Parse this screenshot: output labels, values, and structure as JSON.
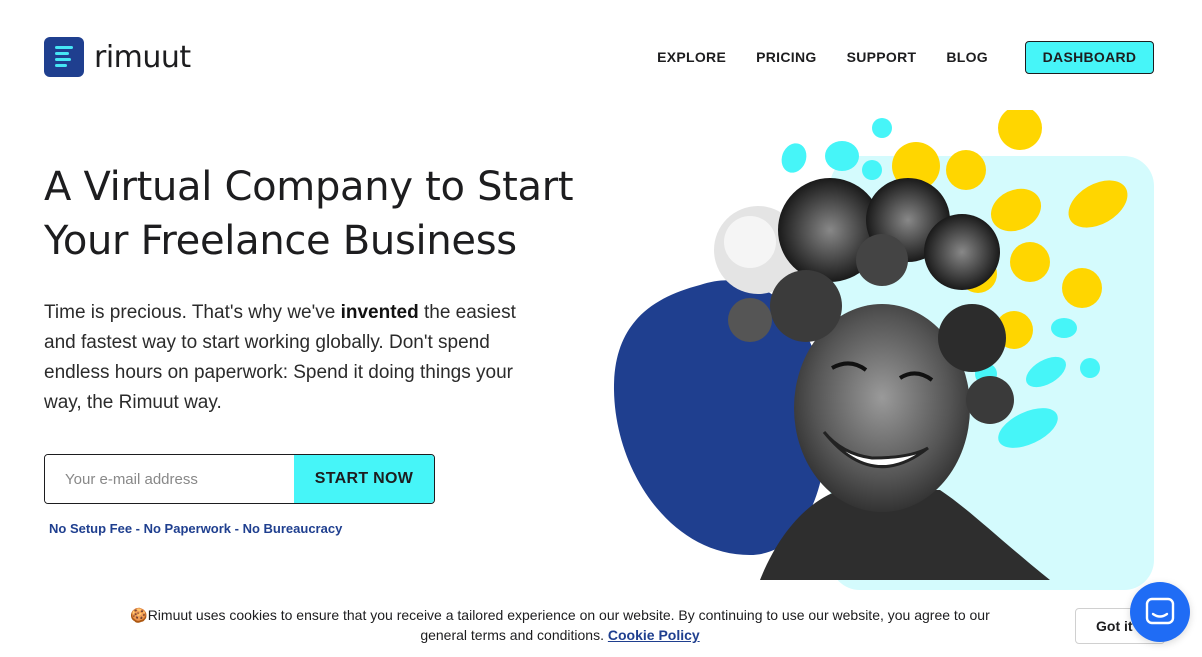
{
  "brand": {
    "name": "rimuut"
  },
  "nav": {
    "items": [
      "EXPLORE",
      "PRICING",
      "SUPPORT",
      "BLOG"
    ],
    "dashboard_label": "DASHBOARD"
  },
  "hero": {
    "title": "A Virtual Company to Start Your Freelance Business",
    "desc_before": "Time is precious. That's why we've ",
    "desc_bold": "invented",
    "desc_after": " the easiest and fastest way to start working globally. Don't spend endless hours on paperwork: Spend it doing things your way, the Rimuut way.",
    "email_placeholder": "Your e-mail address",
    "cta_label": "START NOW",
    "tagline": "No Setup Fee - No Paperwork - No Bureaucracy"
  },
  "cookie": {
    "emoji": "🍪",
    "text": "Rimuut uses cookies to ensure that you receive a tailored experience on our website. By continuing to use our website, you agree to our general terms and conditions.",
    "link_label": "Cookie Policy",
    "accept_label": "Got it"
  },
  "colors": {
    "brand_blue": "#1f3f8f",
    "accent_cyan": "#46f5f8",
    "light_cyan": "#d4fbfd",
    "yellow": "#ffd600",
    "chat_blue": "#1f6cf5"
  },
  "icons": {
    "logo": "rimuut-logo-icon",
    "chat": "chat-bubble-icon",
    "cookie": "cookie-emoji"
  }
}
